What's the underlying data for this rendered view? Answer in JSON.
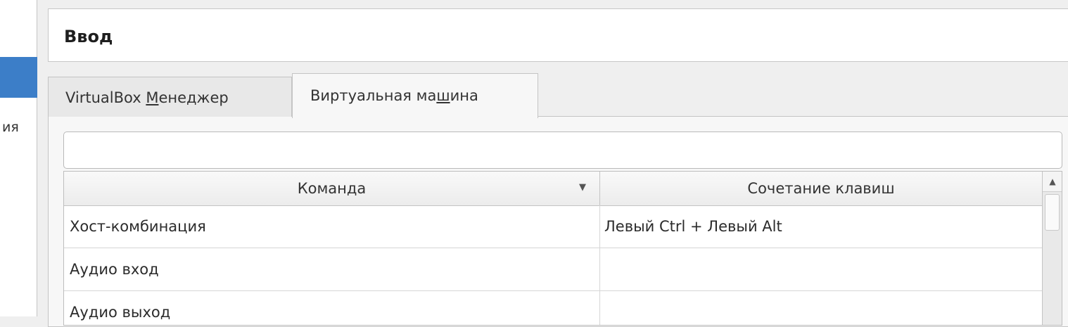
{
  "sidebar": {
    "visible_label_fragment": "ия"
  },
  "header": {
    "title": "Ввод"
  },
  "tabs": [
    {
      "label_before": "VirtualBox ",
      "mnemonic": "М",
      "label_after": "енеджер",
      "active": false
    },
    {
      "label_before": "Виртуальная ма",
      "mnemonic": "ш",
      "label_after": "ина",
      "active": true
    }
  ],
  "filter": {
    "value": "",
    "placeholder": ""
  },
  "table": {
    "columns": [
      "Команда",
      "Сочетание клавиш"
    ],
    "sort_icon": "sort-down-arrow-icon",
    "rows": [
      {
        "command": "Хост-комбинация",
        "shortcut": "Левый Ctrl + Левый Alt"
      },
      {
        "command": "Аудио вход",
        "shortcut": ""
      },
      {
        "command": "Аудио выход",
        "shortcut": ""
      }
    ]
  },
  "colors": {
    "accent": "#3c7ec8",
    "panel": "#f7f7f7",
    "border": "#c4c4c4"
  }
}
